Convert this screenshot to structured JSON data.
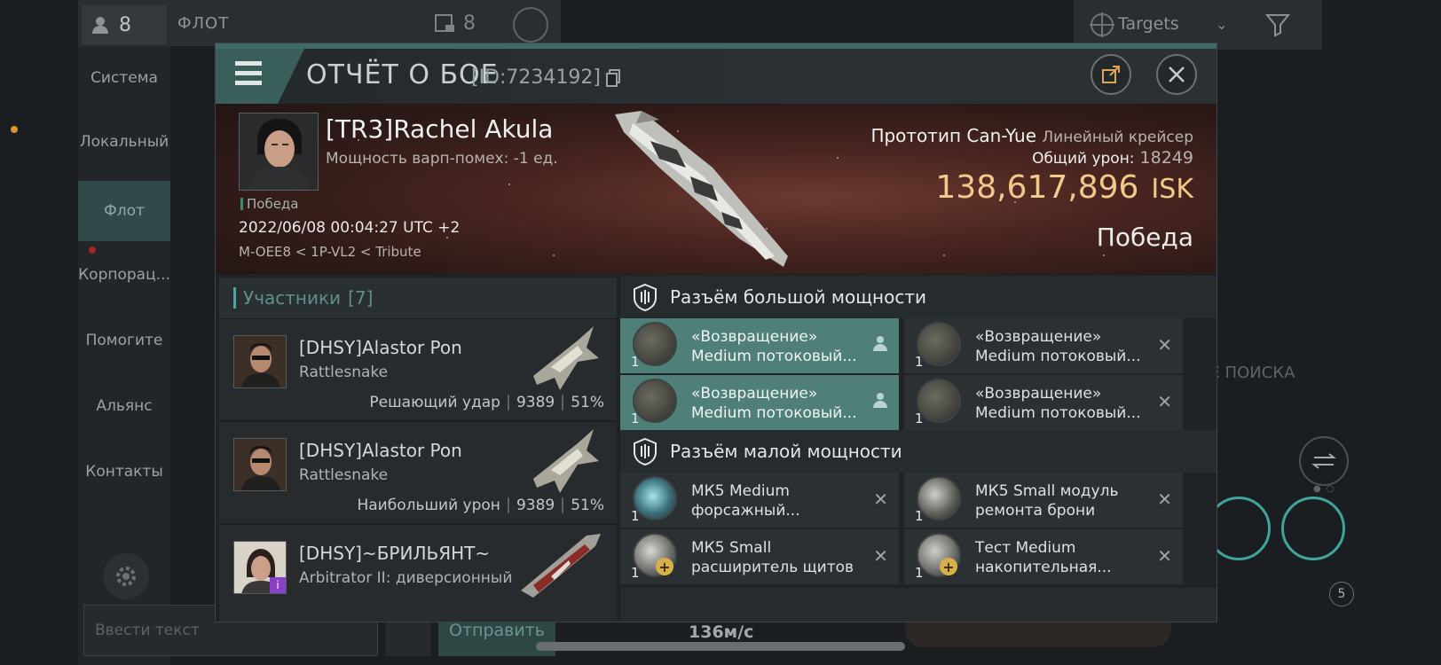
{
  "background": {
    "fleet_count": "8",
    "fleet_title": "ФЛОТ",
    "fleet_number": "8",
    "nav": [
      "Система",
      "Локальный",
      "Флот",
      "Корпорац...",
      "Помогите",
      "Альянс",
      "Контакты"
    ],
    "chat_placeholder": "Ввести текст",
    "send_label": "Отправить",
    "speed": "136м/с",
    "targets_label": "Targets",
    "search_text": "ИЕ ПОИСКА",
    "drone_badge": "5"
  },
  "modal": {
    "title": "ОТЧЁТ О БОЕ",
    "report_id": "[ID:7234192]",
    "victim": {
      "name": "[TR3]Rachel Akula",
      "warp": "Мощность варп-помех: -1 ед.",
      "tag": "Победа",
      "date": "2022/06/08 00:04:27 UTC +2",
      "system": "M-OEE8 < 1P-VL2 < Tribute",
      "ship_name": "Прототип Can-Yue",
      "ship_class": "Линейный крейсер",
      "total_damage_label": "Общий урон:",
      "total_damage": "18249",
      "isk_value": "138,617,896",
      "isk_currency": "ISK",
      "result": "Победа"
    },
    "participants": {
      "title": "Участники",
      "count": "[7]",
      "rows": [
        {
          "name": "[DHSY]Alastor Pon",
          "ship": "Rattlesnake",
          "role": "Решающий удар",
          "damage": "9389",
          "percent": "51%"
        },
        {
          "name": "[DHSY]Alastor Pon",
          "ship": "Rattlesnake",
          "role": "Наибольший урон",
          "damage": "9389",
          "percent": "51%"
        },
        {
          "name": "[DHSY]~БРИЛЬЯНТ~",
          "ship": "Arbitrator II: диверсионный",
          "role": "",
          "damage": "",
          "percent": ""
        }
      ]
    },
    "high_slots": {
      "title": "Разъём большой мощности",
      "items": [
        {
          "line1": "«Возвращение»",
          "line2": "Medium потоковый...",
          "qty": "1"
        },
        {
          "line1": "«Возвращение»",
          "line2": "Medium потоковый...",
          "qty": "1"
        },
        {
          "line1": "«Возвращение»",
          "line2": "Medium потоковый...",
          "qty": "1"
        },
        {
          "line1": "«Возвращение»",
          "line2": "Medium потоковый...",
          "qty": "1"
        }
      ]
    },
    "low_slots": {
      "title": "Разъём малой мощности",
      "items": [
        {
          "line1": "МК5 Medium",
          "line2": "форсажный...",
          "qty": "1"
        },
        {
          "line1": "МК5 Small модуль",
          "line2": "ремонта брони",
          "qty": "1"
        },
        {
          "line1": "МК5 Small",
          "line2": "расширитель щитов",
          "qty": "1"
        },
        {
          "line1": "Тест Medium",
          "line2": "накопительная...",
          "qty": "1"
        }
      ]
    }
  }
}
